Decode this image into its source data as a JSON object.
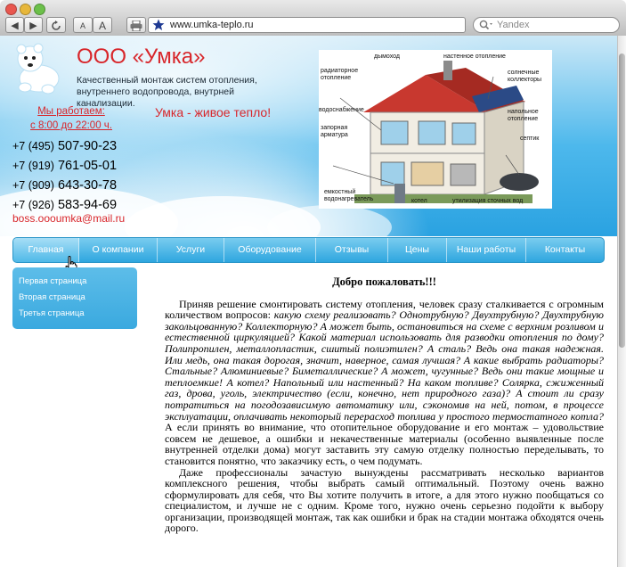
{
  "browser": {
    "back_label": "◀",
    "forward_label": "▶",
    "refresh_icon": "refresh-icon",
    "text_smaller_label": "A",
    "text_larger_label": "A",
    "print_icon": "print-icon",
    "bookmark_icon": "star-icon",
    "url": "www.umka-teplo.ru",
    "search_placeholder": "Yandex",
    "colors": {
      "close": "#e9574f",
      "minimize": "#e7b73b",
      "maximize": "#6cc04a"
    }
  },
  "header": {
    "company_name": "ООО «Умка»",
    "tagline": "Качественный монтаж систем отопления, внутреннего водопровода, внутрней канализации.",
    "hours_line1": "Мы работаем:",
    "hours_line2": "с 8:00 до 22:00 ч.",
    "slogan": "Умка - живое тепло!",
    "phones": [
      {
        "code": "+7 (495)",
        "number": "507-90-23"
      },
      {
        "code": "+7 (919)",
        "number": "761-05-01"
      },
      {
        "code": "+7 (909)",
        "number": "643-30-78"
      },
      {
        "code": "+7 (926)",
        "number": "583-94-69"
      }
    ],
    "email": "boss.oooumka@mail.ru",
    "house_labels": {
      "chimney": "дымоход",
      "wall_heating": "настенное отопление",
      "radiator1": "радиаторное",
      "radiator2": "отопление",
      "solar1": "солнечные",
      "solar2": "коллекторы",
      "water_supply": "водоснабжение",
      "floor1": "напольное",
      "floor2": "отопление",
      "valves1": "запорная",
      "valves2": "арматура",
      "septic": "септик",
      "tank1": "емкостный",
      "tank2": "водонагреватель",
      "boiler": "котел",
      "drain": "утилизация сточных вод"
    }
  },
  "nav": {
    "items": [
      {
        "label": "Главная"
      },
      {
        "label": "О компании"
      },
      {
        "label": "Услуги"
      },
      {
        "label": "Оборудование"
      },
      {
        "label": "Отзывы"
      },
      {
        "label": "Цены"
      },
      {
        "label": "Наши работы"
      },
      {
        "label": "Контакты"
      }
    ]
  },
  "sidebar": {
    "items": [
      {
        "label": "Первая страница"
      },
      {
        "label": "Вторая страница"
      },
      {
        "label": "Третья страница"
      }
    ]
  },
  "main": {
    "title": "Добро пожаловать!!!",
    "p1_intro": "Приняв решение смонтировать систему отопления, человек сразу сталкивается с огромным количеством вопросов: ",
    "p1_questions": "какую схему реализовать? Однотрубную? Двухтрубную? Двухтрубную закольцованную? Коллекторную? А может быть, остановиться на схеме с верхним розливом и естественной циркуляцией? Какой материал использовать для разводки отопления по дому? Полипропилен, металлопластик, сшитый полиэтилен? А сталь? Ведь она такая надежная. Или медь, она такая дорогая, значит, наверное, самая лучшая? А какие выбрать радиаторы? Стальные? Алюминиевые? Биметаллические? А может, чугунные? Ведь они такие мощные и теплоемкие! А котел? Напольный или настенный? На каком топливе? Солярка, сжиженный газ, дрова, уголь, электричество (если, конечно, нет природного газа)? А стоит ли сразу потратиться на погодозависимую автоматику или, сэкономив на ней, потом, в процессе эксплуатации, оплачивать некоторый перерасход топлива у простого термостатного котла?",
    "p1_rest": " А если принять во внимание, что отопительное оборудование и его монтаж – удовольствие совсем не дешевое, а ошибки и некачественные материалы (особенно выявленные после внутренней отделки дома) могут заставить эту самую отделку полностью переделывать, то становится понятно, что заказчику есть, о чем подумать.",
    "p2": "Даже профессионалы зачастую вынуждены рассматривать несколько вариантов комплексного решения, чтобы выбрать самый оптимальный. Поэтому очень важно сформулировать для себя, что Вы хотите получить в итоге, а для этого нужно пообщаться со специалистом, и лучше не с одним. Кроме того, нужно очень серьезно подойти к выбору организации, производящей монтаж, так как ошибки и брак на стадии монтажа обходятся очень дорого."
  }
}
